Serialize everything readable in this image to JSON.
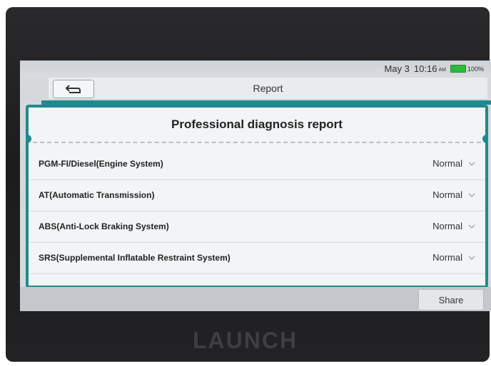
{
  "status_bar": {
    "date": "May 3",
    "time": "10:16",
    "ampm": "AM",
    "battery": "100%"
  },
  "title_bar": {
    "title": "Report",
    "back_icon": "back-arrow-icon"
  },
  "report": {
    "heading": "Professional diagnosis report",
    "rows": [
      {
        "system": "PGM-FI/Diesel(Engine System)",
        "status": "Normal"
      },
      {
        "system": "AT(Automatic Transmission)",
        "status": "Normal"
      },
      {
        "system": "ABS(Anti-Lock Braking System)",
        "status": "Normal"
      },
      {
        "system": "SRS(Supplemental Inflatable Restraint System)",
        "status": "Normal"
      }
    ]
  },
  "actions": {
    "share": "Share"
  },
  "device_brand": "LAUNCH",
  "colors": {
    "accent": "#1f8a8f",
    "battery": "#2bbb3a"
  }
}
